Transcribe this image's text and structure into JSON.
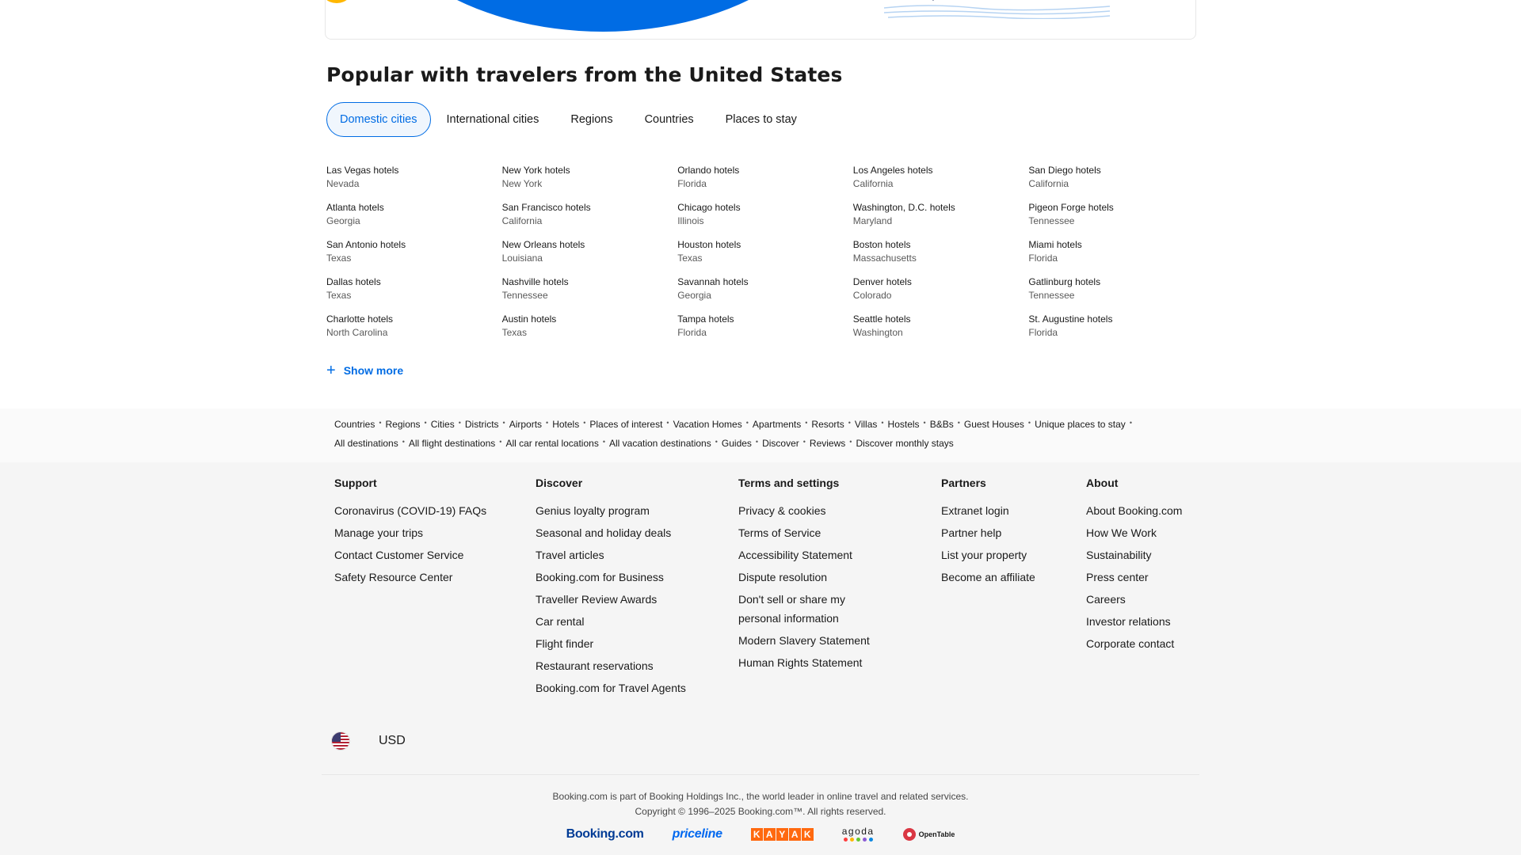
{
  "section_title": "Popular with travelers from the United States",
  "tabs": [
    "Domestic cities",
    "International cities",
    "Regions",
    "Countries",
    "Places to stay"
  ],
  "cities": [
    {
      "name": "Las Vegas hotels",
      "region": "Nevada"
    },
    {
      "name": "New York hotels",
      "region": "New York"
    },
    {
      "name": "Orlando hotels",
      "region": "Florida"
    },
    {
      "name": "Los Angeles hotels",
      "region": "California"
    },
    {
      "name": "San Diego hotels",
      "region": "California"
    },
    {
      "name": "Atlanta hotels",
      "region": "Georgia"
    },
    {
      "name": "San Francisco hotels",
      "region": "California"
    },
    {
      "name": "Chicago hotels",
      "region": "Illinois"
    },
    {
      "name": "Washington, D.C. hotels",
      "region": "Maryland"
    },
    {
      "name": "Pigeon Forge hotels",
      "region": "Tennessee"
    },
    {
      "name": "San Antonio hotels",
      "region": "Texas"
    },
    {
      "name": "New Orleans hotels",
      "region": "Louisiana"
    },
    {
      "name": "Houston hotels",
      "region": "Texas"
    },
    {
      "name": "Boston hotels",
      "region": "Massachusetts"
    },
    {
      "name": "Miami hotels",
      "region": "Florida"
    },
    {
      "name": "Dallas hotels",
      "region": "Texas"
    },
    {
      "name": "Nashville hotels",
      "region": "Tennessee"
    },
    {
      "name": "Savannah hotels",
      "region": "Georgia"
    },
    {
      "name": "Denver hotels",
      "region": "Colorado"
    },
    {
      "name": "Gatlinburg hotels",
      "region": "Tennessee"
    },
    {
      "name": "Charlotte hotels",
      "region": "North Carolina"
    },
    {
      "name": "Austin hotels",
      "region": "Texas"
    },
    {
      "name": "Tampa hotels",
      "region": "Florida"
    },
    {
      "name": "Seattle hotels",
      "region": "Washington"
    },
    {
      "name": "St. Augustine hotels",
      "region": "Florida"
    }
  ],
  "show_more": "Show more",
  "link_rows": [
    [
      "Countries",
      "Regions",
      "Cities",
      "Districts",
      "Airports",
      "Hotels",
      "Places of interest",
      "Vacation Homes",
      "Apartments",
      "Resorts",
      "Villas",
      "Hostels",
      "B&Bs",
      "Guest Houses",
      "Unique places to stay"
    ],
    [
      "All destinations",
      "All flight destinations",
      "All car rental locations",
      "All vacation destinations",
      "Guides",
      "Discover",
      "Reviews",
      "Discover monthly stays"
    ]
  ],
  "footer": {
    "support": {
      "title": "Support",
      "links": [
        "Coronavirus (COVID-19) FAQs",
        "Manage your trips",
        "Contact Customer Service",
        "Safety Resource Center"
      ]
    },
    "discover": {
      "title": "Discover",
      "links": [
        "Genius loyalty program",
        "Seasonal and holiday deals",
        "Travel articles",
        "Booking.com for Business",
        "Traveller Review Awards",
        "Car rental",
        "Flight finder",
        "Restaurant reservations",
        "Booking.com for Travel Agents"
      ]
    },
    "terms": {
      "title": "Terms and settings",
      "links": [
        "Privacy & cookies",
        "Terms of Service",
        "Accessibility Statement",
        "Dispute resolution",
        "Don't sell or share my personal information",
        "Modern Slavery Statement",
        "Human Rights Statement"
      ]
    },
    "partners": {
      "title": "Partners",
      "links": [
        "Extranet login",
        "Partner help",
        "List your property",
        "Become an affiliate"
      ]
    },
    "about": {
      "title": "About",
      "links": [
        "About Booking.com",
        "How We Work",
        "Sustainability",
        "Press center",
        "Careers",
        "Investor relations",
        "Corporate contact"
      ]
    }
  },
  "currency": "USD",
  "legal_line1": "Booking.com is part of Booking Holdings Inc., the world leader in online travel and related services.",
  "legal_line2": "Copyright © 1996–2025 Booking.com™. All rights reserved.",
  "brands": {
    "booking": "Booking.com",
    "priceline": "priceline",
    "kayak": [
      "K",
      "A",
      "Y",
      "A",
      "K"
    ],
    "agoda": "agoda",
    "opentable": "OpenTable"
  },
  "colors": {
    "accent": "#006ce4",
    "brand_dark": "#003b95",
    "kayak": "#ff690f"
  }
}
